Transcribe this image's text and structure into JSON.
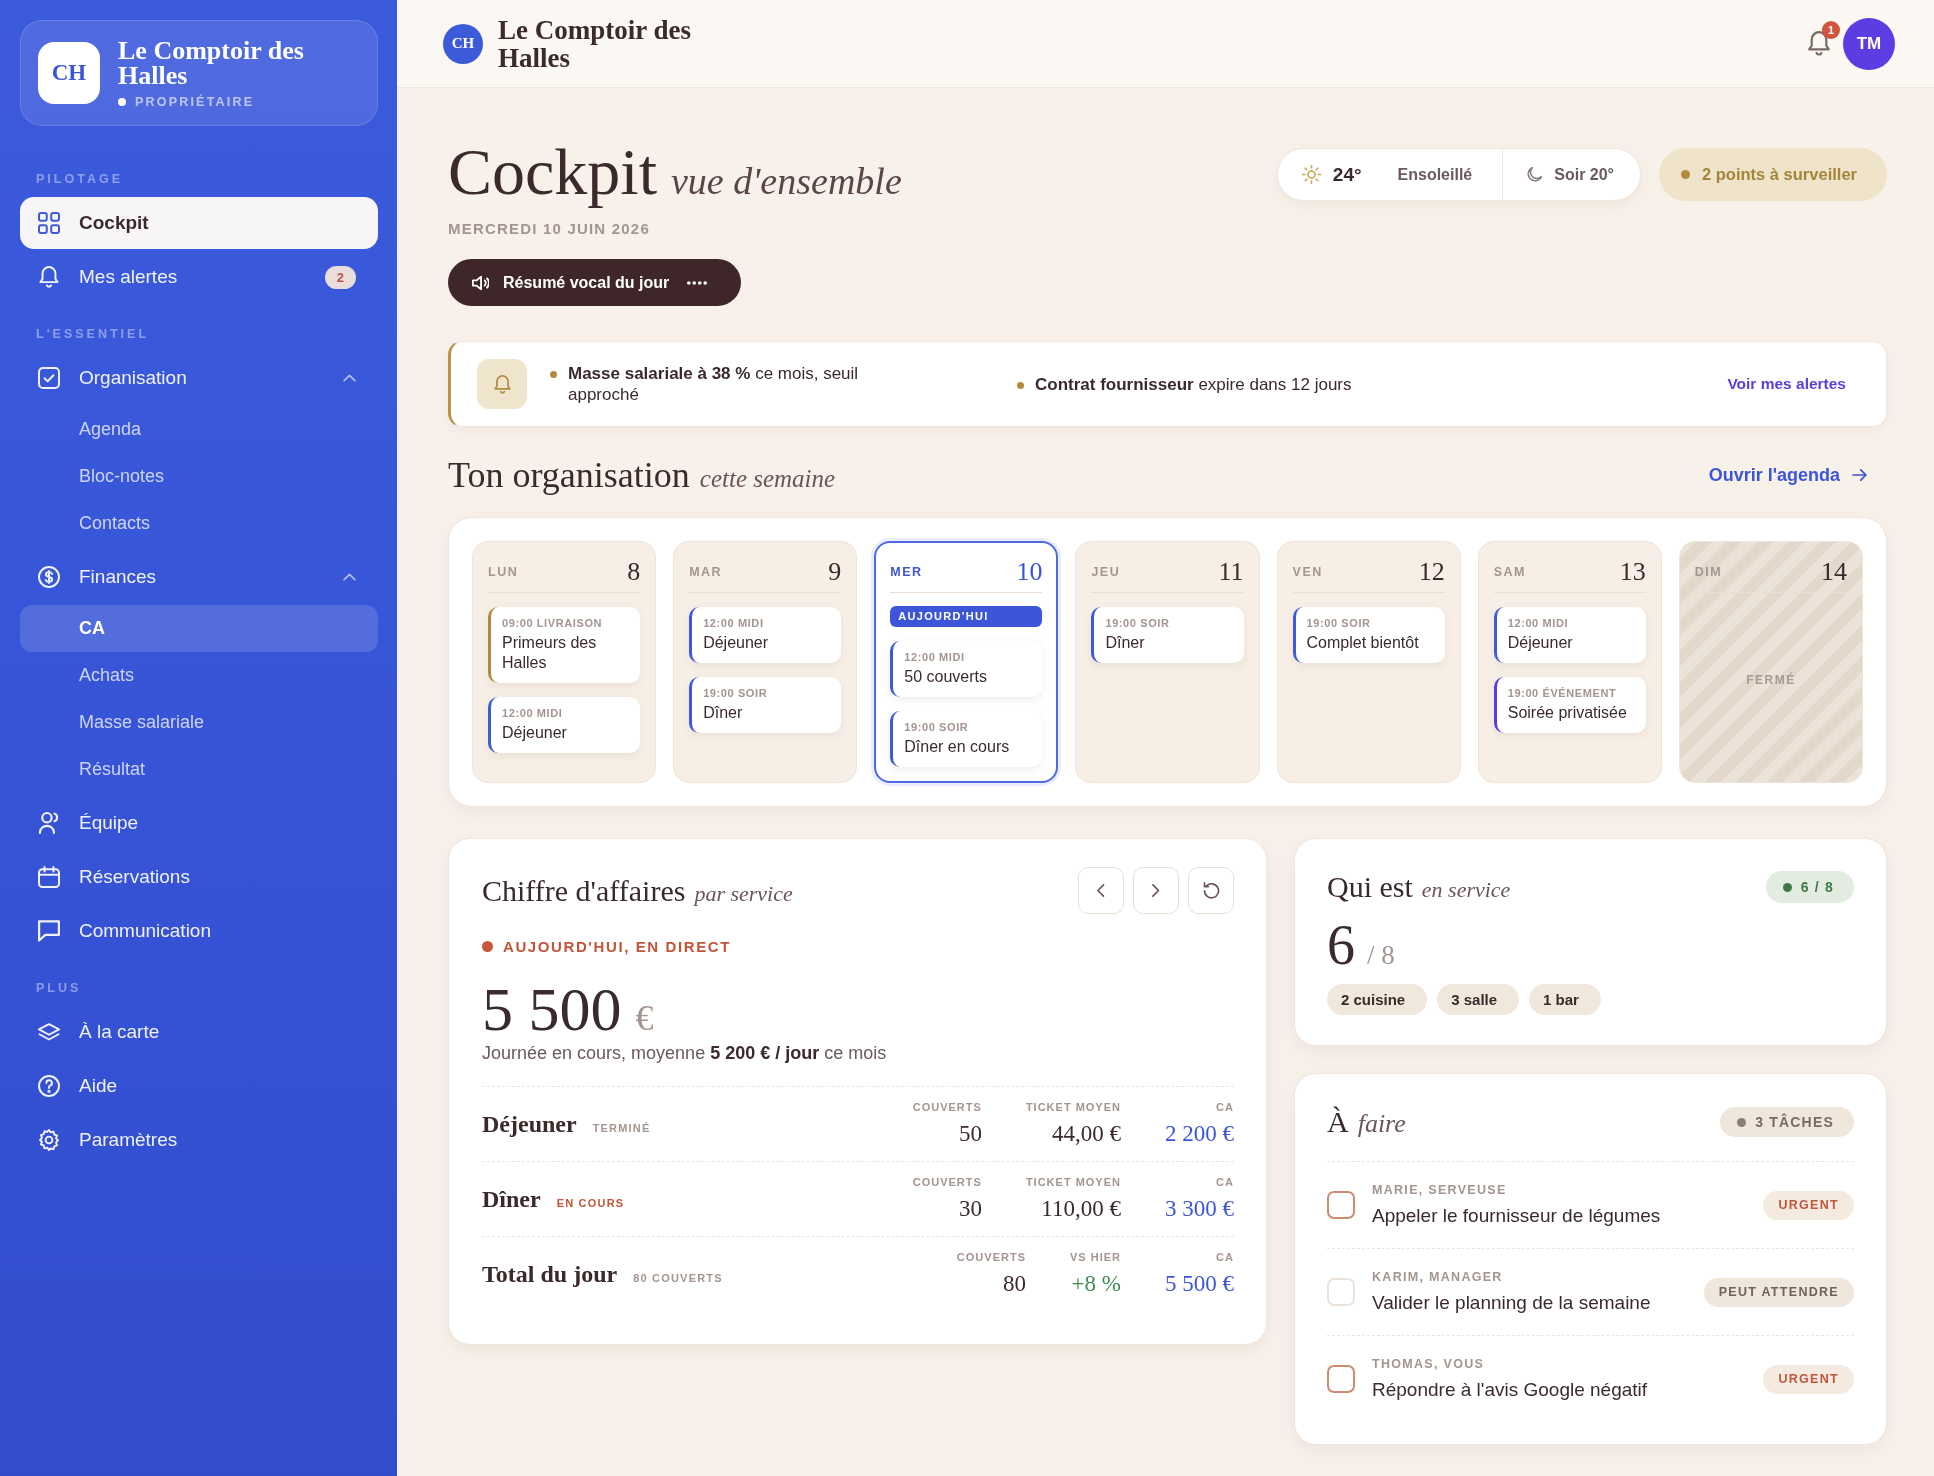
{
  "sidebar": {
    "brand": {
      "logo": "CH",
      "name": "Le Comptoir des Halles",
      "role": "PROPRIÉTAIRE"
    },
    "sections": [
      {
        "label": "PILOTAGE",
        "items": [
          {
            "label": "Cockpit",
            "selected": true
          },
          {
            "label": "Mes alertes",
            "selected": false,
            "badge": "2"
          }
        ]
      },
      {
        "label": "L'ESSENTIEL",
        "items": [
          {
            "label": "Organisation",
            "selected": false,
            "expanded": true,
            "children": [
              {
                "label": "Agenda",
                "selected": false
              },
              {
                "label": "Bloc-notes",
                "selected": false
              },
              {
                "label": "Contacts",
                "selected": false
              }
            ]
          },
          {
            "label": "Finances",
            "selected": false,
            "expanded": true,
            "children": [
              {
                "label": "CA",
                "selected": true
              },
              {
                "label": "Achats",
                "selected": false
              },
              {
                "label": "Masse salariale",
                "selected": false
              },
              {
                "label": "Résultat",
                "selected": false
              }
            ]
          },
          {
            "label": "Équipe",
            "selected": false
          },
          {
            "label": "Réservations",
            "selected": false
          },
          {
            "label": "Communication",
            "selected": false
          }
        ]
      },
      {
        "label": "PLUS",
        "items": [
          {
            "label": "À la carte",
            "selected": false
          },
          {
            "label": "Aide",
            "selected": false
          },
          {
            "label": "Paramètres",
            "selected": false
          }
        ]
      }
    ]
  },
  "header": {
    "logo": "CH",
    "name": "Le Comptoir des Halles",
    "notifications": "1",
    "avatar": "TM"
  },
  "page": {
    "title": "Cockpit",
    "subtitle": "vue d'ensemble",
    "date": "MERCREDI 10 JUIN 2026",
    "voice_button": "Résumé vocal du jour",
    "weather": {
      "temperature": "24°",
      "condition": "Ensoleillé",
      "evening": "Soir 20°"
    },
    "watch": "2 points à surveiller"
  },
  "alerts": {
    "items": [
      "**Masse salariale à 38 %** ce mois, seuil approché",
      "**Contrat fournisseur** expire dans 12 jours"
    ],
    "link": "Voir mes alertes"
  },
  "organisation": {
    "title": "Ton organisation",
    "subtitle": "cette semaine",
    "link": "Ouvrir l'agenda",
    "days": [
      {
        "day": "LUN",
        "date": "8",
        "selected": false,
        "closed": false,
        "events": [
          {
            "time": "09:00 LIVRAISON",
            "title": "Primeurs des Halles",
            "color": "#b08a3e"
          },
          {
            "time": "12:00 MIDI",
            "title": "Déjeuner",
            "color": "#3d5bd9"
          }
        ]
      },
      {
        "day": "MAR",
        "date": "9",
        "selected": false,
        "closed": false,
        "events": [
          {
            "time": "12:00 MIDI",
            "title": "Déjeuner",
            "color": "#3d5bd9"
          },
          {
            "time": "19:00 SOIR",
            "title": "Dîner",
            "color": "#3d5bd9"
          }
        ]
      },
      {
        "day": "MER",
        "date": "10",
        "selected": true,
        "closed": false,
        "badge": "AUJOURD'HUI",
        "events": [
          {
            "time": "12:00 MIDI",
            "title": "50 couverts",
            "color": "#3d5bd9"
          },
          {
            "time": "19:00 SOIR",
            "title": "Dîner en cours",
            "color": "#3d5bd9"
          }
        ]
      },
      {
        "day": "JEU",
        "date": "11",
        "selected": false,
        "closed": false,
        "events": [
          {
            "time": "19:00 SOIR",
            "title": "Dîner",
            "color": "#3d5bd9"
          }
        ]
      },
      {
        "day": "VEN",
        "date": "12",
        "selected": false,
        "closed": false,
        "events": [
          {
            "time": "19:00 SOIR",
            "title": "Complet bientôt",
            "color": "#3d5bd9"
          }
        ]
      },
      {
        "day": "SAM",
        "date": "13",
        "selected": false,
        "closed": false,
        "events": [
          {
            "time": "12:00 MIDI",
            "title": "Déjeuner",
            "color": "#3d5bd9"
          },
          {
            "time": "19:00 ÉVÉNEMENT",
            "title": "Soirée privatisée",
            "color": "#5a3de0"
          }
        ]
      },
      {
        "day": "DIM",
        "date": "14",
        "selected": false,
        "closed": true,
        "closed_label": "FERMÉ"
      }
    ]
  },
  "revenue": {
    "title": "Chiffre d'affaires",
    "subtitle": "par service",
    "live": "AUJOURD'HUI, EN DIRECT",
    "amount": "5 500",
    "currency": "€",
    "note": "Journée en cours, moyenne **5 200 € / jour** ce mois",
    "rows": [
      {
        "name": "Déjeuner",
        "status": "TERMINÉ",
        "kind": "done",
        "stats": [
          {
            "label": "COUVERTS",
            "value": "50",
            "kind": "plain"
          },
          {
            "label": "TICKET MOYEN",
            "value": "44,00 €",
            "kind": "plain"
          },
          {
            "label": "CA",
            "value": "2 200 €",
            "kind": "revenue"
          }
        ]
      },
      {
        "name": "Dîner",
        "status": "EN COURS",
        "kind": "live",
        "stats": [
          {
            "label": "COUVERTS",
            "value": "30",
            "kind": "plain"
          },
          {
            "label": "TICKET MOYEN",
            "value": "110,00 €",
            "kind": "plain"
          },
          {
            "label": "CA",
            "value": "3 300 €",
            "kind": "revenue"
          }
        ]
      },
      {
        "name": "Total du jour",
        "status": "80 COUVERTS",
        "kind": "total",
        "stats": [
          {
            "label": "COUVERTS",
            "value": "80",
            "kind": "plain"
          },
          {
            "label": "VS HIER",
            "value": "+8 %",
            "kind": "delta"
          },
          {
            "label": "CA",
            "value": "5 500 €",
            "kind": "revenue"
          }
        ]
      }
    ]
  },
  "staff": {
    "title": "Qui est",
    "subtitle": "en service",
    "badge": "6 / 8",
    "count": "6",
    "total": "/ 8",
    "roles": [
      "2 cuisine",
      "3 salle",
      "1 bar"
    ]
  },
  "tasks": {
    "title": "À",
    "subtitle": "faire",
    "badge": "3 TÂCHES",
    "items": [
      {
        "who": "MARIE, SERVEUSE",
        "title": "Appeler le fournisseur de légumes",
        "priority": "URGENT",
        "kind": "urgent",
        "checked": false
      },
      {
        "who": "KARIM, MANAGER",
        "title": "Valider le planning de la semaine",
        "priority": "PEUT ATTENDRE",
        "kind": "later",
        "checked": false
      },
      {
        "who": "THOMAS, VOUS",
        "title": "Répondre à l'avis Google négatif",
        "priority": "URGENT",
        "kind": "urgent",
        "checked": false
      }
    ]
  }
}
